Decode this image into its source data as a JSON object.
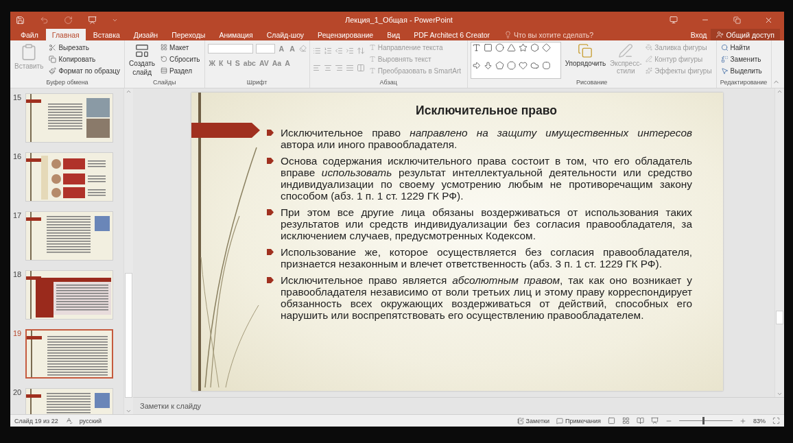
{
  "window": {
    "title": "Лекция_1_Общая - PowerPoint",
    "sign_in": "Вход",
    "share": "Общий доступ"
  },
  "tabs": [
    {
      "label": "Файл",
      "selected": false
    },
    {
      "label": "Главная",
      "selected": true
    },
    {
      "label": "Вставка",
      "selected": false
    },
    {
      "label": "Дизайн",
      "selected": false
    },
    {
      "label": "Переходы",
      "selected": false
    },
    {
      "label": "Анимация",
      "selected": false
    },
    {
      "label": "Слайд-шоу",
      "selected": false
    },
    {
      "label": "Рецензирование",
      "selected": false
    },
    {
      "label": "Вид",
      "selected": false
    },
    {
      "label": "PDF Architect 6 Creator",
      "selected": false
    }
  ],
  "tell_me": {
    "placeholder": "Что вы хотите сделать?"
  },
  "ribbon": {
    "clipboard": {
      "label": "Буфер обмена",
      "paste": {
        "label": "Вставить",
        "disabled": true
      },
      "items": [
        {
          "label": "Вырезать",
          "disabled": false
        },
        {
          "label": "Копировать",
          "disabled": false
        },
        {
          "label": "Формат по образцу",
          "disabled": false
        }
      ]
    },
    "slides": {
      "label": "Слайды",
      "new_slide": [
        "Создать",
        "слайд"
      ],
      "items": [
        {
          "label": "Макет",
          "disabled": false
        },
        {
          "label": "Сбросить",
          "disabled": false
        },
        {
          "label": "Раздел",
          "disabled": false
        }
      ]
    },
    "font": {
      "label": "Шрифт",
      "size_buttons": [
        "A",
        "A"
      ],
      "format_buttons": [
        "Ж",
        "К",
        "Ч",
        "S",
        "abc",
        "AV",
        "Aa",
        "A"
      ]
    },
    "paragraph": {
      "label": "Абзац",
      "items": [
        {
          "label": "Направление текста",
          "disabled": true
        },
        {
          "label": "Выровнять текст",
          "disabled": true
        },
        {
          "label": "Преобразовать в SmartArt",
          "disabled": true
        }
      ]
    },
    "drawing": {
      "label": "Рисование",
      "arrange": "Упорядочить",
      "quick_styles": {
        "label": "Экспресс-стили",
        "disabled": true
      },
      "items": [
        {
          "label": "Заливка фигуры",
          "disabled": true
        },
        {
          "label": "Контур фигуры",
          "disabled": true
        },
        {
          "label": "Эффекты фигуры",
          "disabled": true
        }
      ]
    },
    "editing": {
      "label": "Редактирование",
      "items": [
        {
          "label": "Найти",
          "disabled": false
        },
        {
          "label": "Заменить",
          "disabled": false
        },
        {
          "label": "Выделить",
          "disabled": false
        }
      ]
    }
  },
  "thumbnails": [
    {
      "number": "15",
      "kind": "images",
      "selected": false
    },
    {
      "number": "16",
      "kind": "diagram",
      "selected": false
    },
    {
      "number": "17",
      "kind": "text-image",
      "selected": false
    },
    {
      "number": "18",
      "kind": "table",
      "selected": false
    },
    {
      "number": "19",
      "kind": "text",
      "selected": true
    },
    {
      "number": "20",
      "kind": "text-image",
      "selected": false
    }
  ],
  "slide": {
    "title": "Исключительное право",
    "bullets": [
      "Исключительное право *направлено на защиту имущественных интересов* автора или иного правообладателя.",
      "Основа содержания исключительного права состоит в том, что его обладатель вправе *использовать* результат интеллектуальной деятельности или средство индивидуализации по своему усмотрению любым не противоречащим закону способом (абз. 1 п. 1 ст. 1229 ГК РФ).",
      "При этом все другие лица обязаны воздерживаться от использования таких результатов или средств индивидуализации без согласия правообладателя, за исключением случаев, предусмотренных Кодексом.",
      "Использование же, которое осуществляется без согласия правообладателя, признается незаконным и влечет ответственность (абз. 3 п. 1 ст. 1229 ГК РФ).",
      "Исключительное право является *абсолютным правом*, так как оно возникает у правообладателя независимо от воли третьих лиц и этому праву корреспондирует обязанность всех окружающих воздерживаться от действий, способных его нарушить или воспрепятствовать его осуществлению правообладателем."
    ]
  },
  "notes": {
    "placeholder": "Заметки к слайду"
  },
  "status_bar": {
    "slide_info": "Слайд 19 из 22",
    "language": "русский",
    "notes": "Заметки",
    "comments": "Примечания",
    "zoom": "83%",
    "zoom_slider": {
      "level": 0.45
    }
  }
}
